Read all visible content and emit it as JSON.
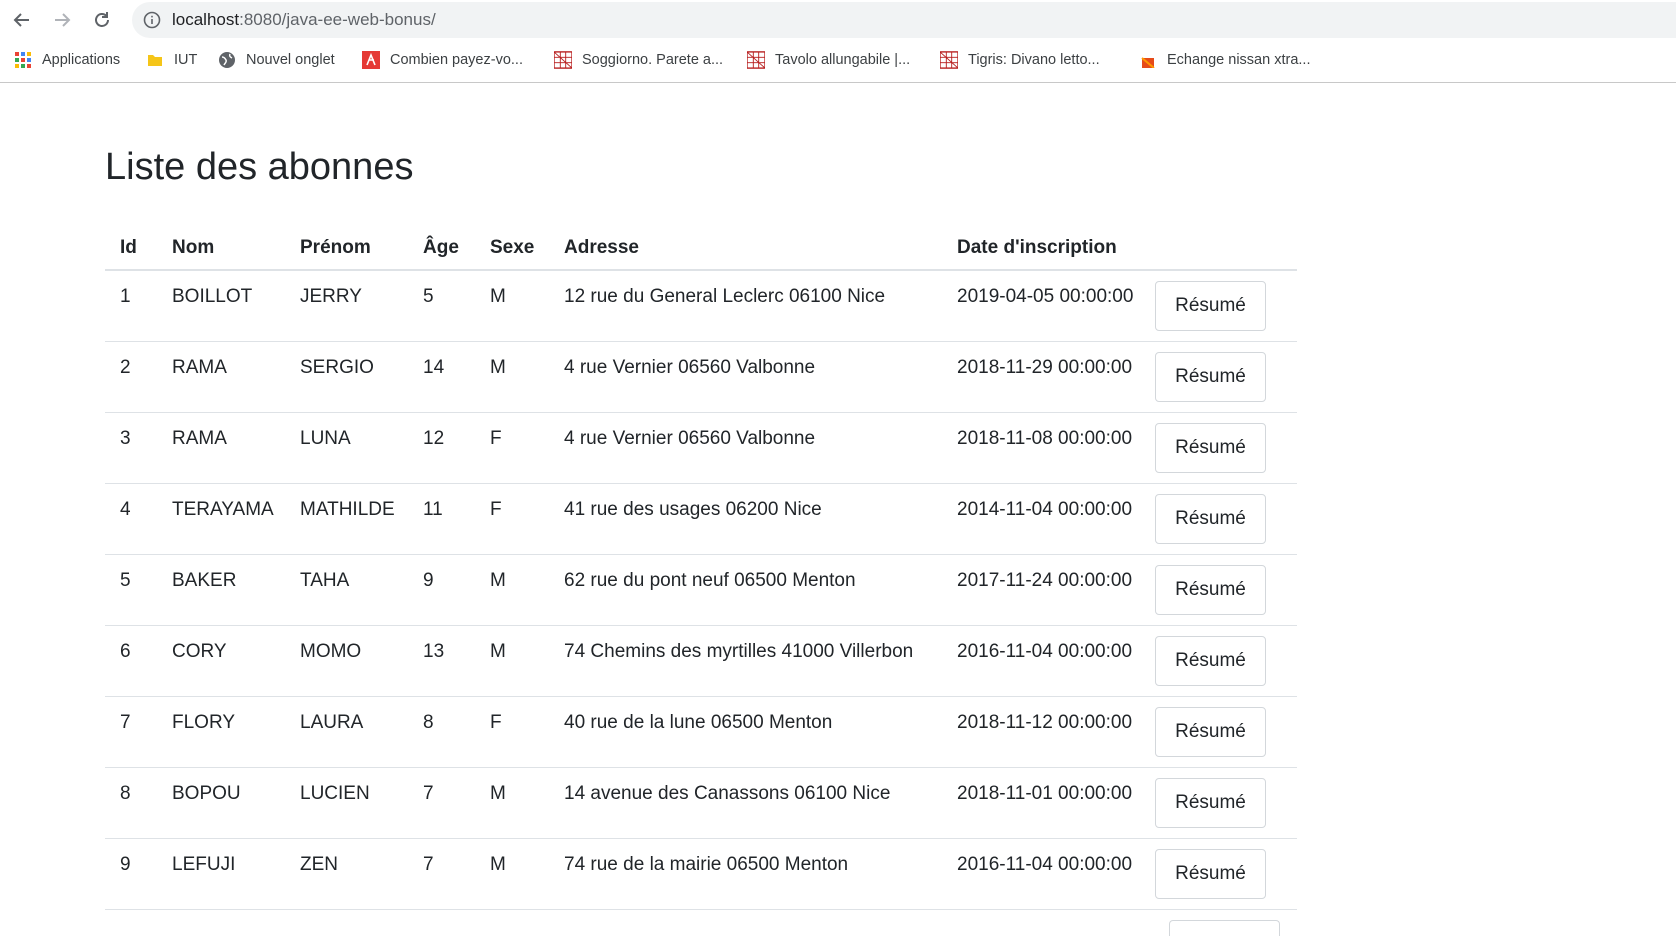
{
  "browser": {
    "url_host": "localhost",
    "url_path": ":8080/java-ee-web-bonus/",
    "bookmarks": [
      {
        "label": "Applications",
        "icon": "apps-grid-icon"
      },
      {
        "label": "IUT",
        "icon": "folder-icon"
      },
      {
        "label": "Nouvel onglet",
        "icon": "globe-icon"
      },
      {
        "label": "Combien payez-vo...",
        "icon": "site-favicon-red"
      },
      {
        "label": "Soggiorno. Parete a...",
        "icon": "site-favicon-grid"
      },
      {
        "label": "Tavolo allungabile |...",
        "icon": "site-favicon-grid"
      },
      {
        "label": "Tigris: Divano letto...",
        "icon": "site-favicon-grid"
      },
      {
        "label": "Echange nissan xtra...",
        "icon": "site-favicon-orange"
      }
    ]
  },
  "page": {
    "title": "Liste des abonnes",
    "columns": [
      "Id",
      "Nom",
      "Prénom",
      "Âge",
      "Sexe",
      "Adresse",
      "Date d'inscription"
    ],
    "button_label": "Résumé",
    "rows": [
      {
        "id": "1",
        "nom": "BOILLOT",
        "prenom": "JERRY",
        "age": "5",
        "sexe": "M",
        "adresse": "12 rue du General Leclerc 06100 Nice",
        "date": "2019-04-05 00:00:00"
      },
      {
        "id": "2",
        "nom": "RAMA",
        "prenom": "SERGIO",
        "age": "14",
        "sexe": "M",
        "adresse": "4 rue Vernier 06560 Valbonne",
        "date": "2018-11-29 00:00:00"
      },
      {
        "id": "3",
        "nom": "RAMA",
        "prenom": "LUNA",
        "age": "12",
        "sexe": "F",
        "adresse": "4 rue Vernier 06560 Valbonne",
        "date": "2018-11-08 00:00:00"
      },
      {
        "id": "4",
        "nom": "TERAYAMA",
        "prenom": "MATHILDE",
        "age": "11",
        "sexe": "F",
        "adresse": "41 rue des usages 06200 Nice",
        "date": "2014-11-04 00:00:00"
      },
      {
        "id": "5",
        "nom": "BAKER",
        "prenom": "TAHA",
        "age": "9",
        "sexe": "M",
        "adresse": "62 rue du pont neuf 06500 Menton",
        "date": "2017-11-24 00:00:00"
      },
      {
        "id": "6",
        "nom": "CORY",
        "prenom": "MOMO",
        "age": "13",
        "sexe": "M",
        "adresse": "74 Chemins des myrtilles 41000 Villerbon",
        "date": "2016-11-04 00:00:00"
      },
      {
        "id": "7",
        "nom": "FLORY",
        "prenom": "LAURA",
        "age": "8",
        "sexe": "F",
        "adresse": "40 rue de la lune 06500 Menton",
        "date": "2018-11-12 00:00:00"
      },
      {
        "id": "8",
        "nom": "BOPOU",
        "prenom": "LUCIEN",
        "age": "7",
        "sexe": "M",
        "adresse": "14 avenue des Canassons 06100 Nice",
        "date": "2018-11-01 00:00:00"
      },
      {
        "id": "9",
        "nom": "LEFUJI",
        "prenom": "ZEN",
        "age": "7",
        "sexe": "M",
        "adresse": "74 rue de la mairie 06500 Menton",
        "date": "2016-11-04 00:00:00"
      }
    ]
  }
}
